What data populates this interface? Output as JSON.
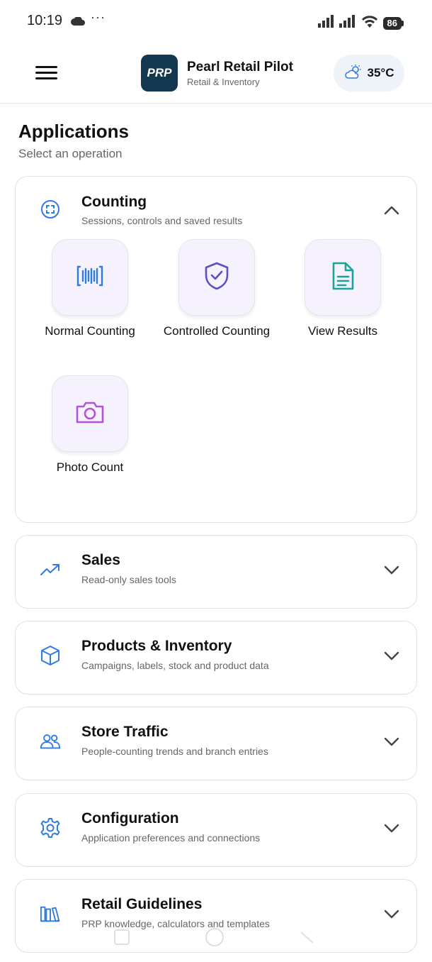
{
  "status_bar": {
    "time": "10:19",
    "more": "···",
    "battery": "86"
  },
  "header": {
    "logo_text": "PRP",
    "app_name": "Pearl Retail Pilot",
    "app_subtitle": "Retail & Inventory",
    "weather_temp": "35°C",
    "weather_icon": "partly-cloudy-icon"
  },
  "page": {
    "title": "Applications",
    "subtitle": "Select an operation"
  },
  "sections": [
    {
      "title": "Counting",
      "description": "Sessions, controls and saved results",
      "icon": "scan-frame-icon",
      "expanded": true,
      "items": [
        {
          "label": "Normal Counting",
          "icon": "barcode-icon",
          "color": "#2f7be0"
        },
        {
          "label": "Controlled Counting",
          "icon": "shield-check-icon",
          "color": "#5b4fc4"
        },
        {
          "label": "View Results",
          "icon": "document-icon",
          "color": "#1ba29a"
        },
        {
          "label": "Photo Count",
          "icon": "camera-icon",
          "color": "#b055d6"
        }
      ]
    },
    {
      "title": "Sales",
      "description": "Read-only sales tools",
      "icon": "trend-up-icon",
      "expanded": false
    },
    {
      "title": "Products & Inventory",
      "description": "Campaigns, labels, stock and product data",
      "icon": "cube-icon",
      "expanded": false
    },
    {
      "title": "Store Traffic",
      "description": "People-counting trends and branch entries",
      "icon": "people-icon",
      "expanded": false
    },
    {
      "title": "Configuration",
      "description": "Application preferences and connections",
      "icon": "gear-icon",
      "expanded": false
    },
    {
      "title": "Retail Guidelines",
      "description": "PRP knowledge, calculators and templates",
      "icon": "books-icon",
      "expanded": false
    }
  ],
  "colors": {
    "accent_blue": "#2f7be0",
    "logo_bg": "#12374f",
    "tile_bg": "#f6f2fd",
    "weather_bg": "#eef2f9"
  }
}
